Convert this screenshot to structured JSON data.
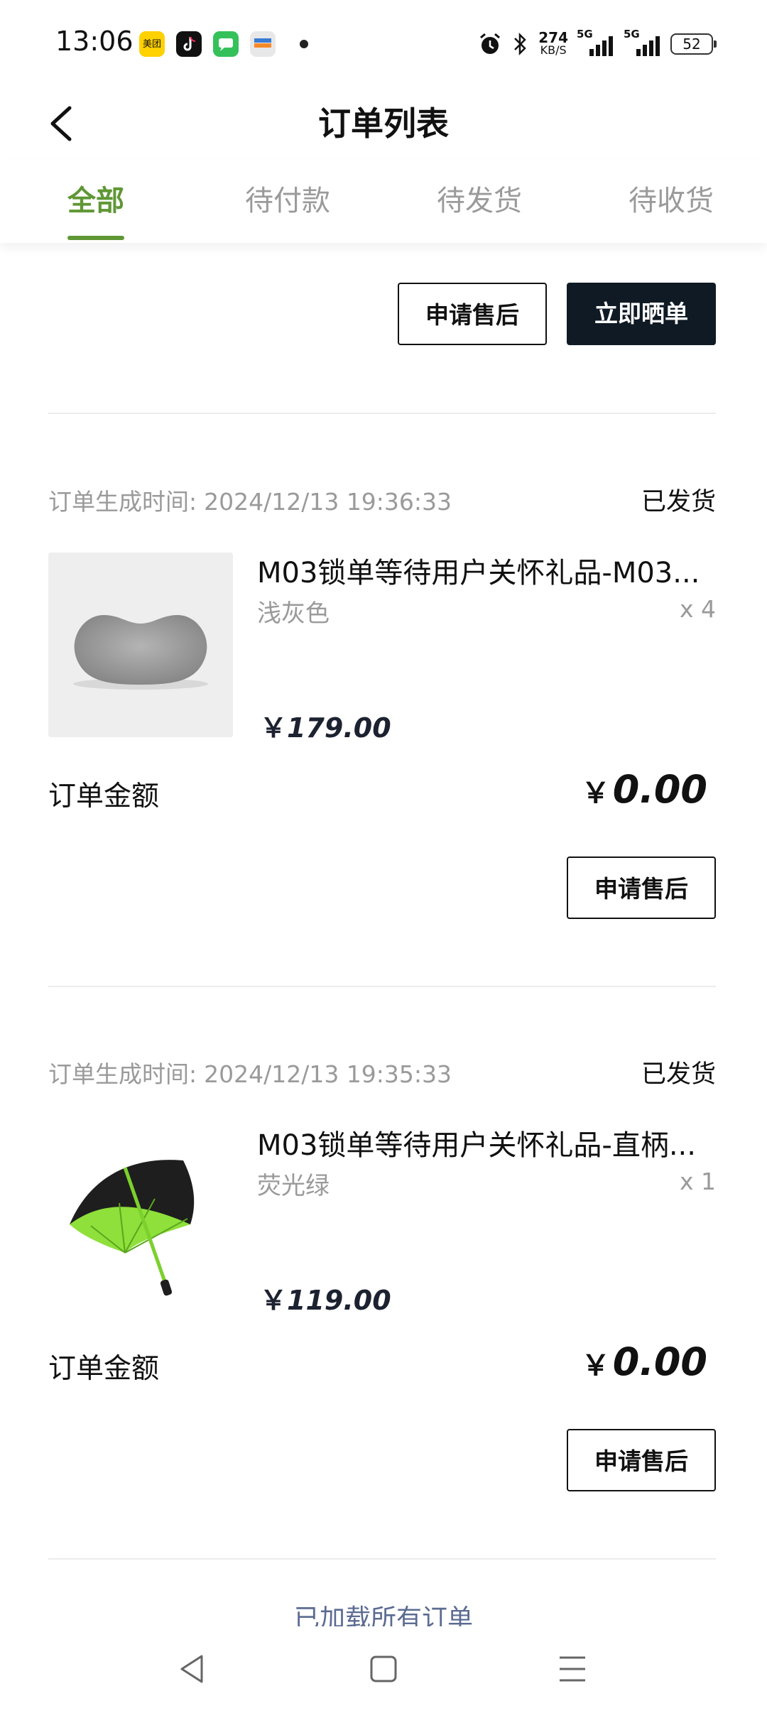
{
  "status_bar": {
    "time": "13:06",
    "apps": [
      {
        "name": "meituan",
        "label": "美团",
        "color": "#ffd100"
      },
      {
        "name": "douyin",
        "label": "",
        "color": "#111111"
      },
      {
        "name": "message",
        "label": "",
        "color": "#35c15a"
      },
      {
        "name": "wallet",
        "label": "",
        "color": "#e8e8e8"
      }
    ],
    "net_speed_value": "274",
    "net_speed_unit": "KB/S",
    "signal_1": "5G",
    "signal_2": "5G",
    "battery": "52"
  },
  "header": {
    "title": "订单列表"
  },
  "tabs": [
    {
      "label": "全部",
      "active": true
    },
    {
      "label": "待付款",
      "active": false
    },
    {
      "label": "待发货",
      "active": false
    },
    {
      "label": "待收货",
      "active": false
    }
  ],
  "top_order": {
    "after_sale_label": "申请售后",
    "review_label": "立即晒单"
  },
  "orders": [
    {
      "time_label": "订单生成时间:",
      "time": "2024/12/13 19:36:33",
      "status": "已发货",
      "product": {
        "name": "M03锁单等待用户关怀礼品-M03...",
        "spec": "浅灰色",
        "qty": "x 4",
        "currency": "￥",
        "price": "179.00",
        "image": "grey-neck-pillow"
      },
      "total_label": "订单金额",
      "total_currency": "￥",
      "total": "0.00",
      "after_sale_label": "申请售后"
    },
    {
      "time_label": "订单生成时间:",
      "time": "2024/12/13 19:35:33",
      "status": "已发货",
      "product": {
        "name": "M03锁单等待用户关怀礼品-直柄...",
        "spec": "荧光绿",
        "qty": "x 1",
        "currency": "￥",
        "price": "119.00",
        "image": "green-umbrella"
      },
      "total_label": "订单金额",
      "total_currency": "￥",
      "total": "0.00",
      "after_sale_label": "申请售后"
    }
  ],
  "footer": {
    "loaded_text": "已加载所有订单"
  },
  "system_nav": {
    "back": "back-triangle-icon",
    "home": "home-square-icon",
    "menu": "menu-lines-icon"
  },
  "colors": {
    "accent": "#5f9735",
    "dark_button": "#0f1a24",
    "muted_text": "#9a9a9a"
  }
}
